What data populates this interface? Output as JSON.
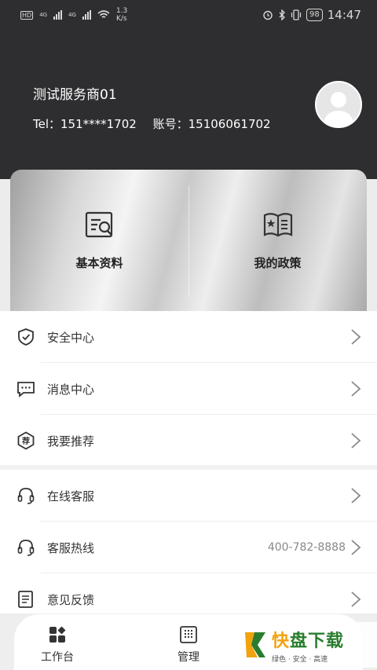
{
  "status_bar": {
    "left_badges": [
      "HD",
      "4G",
      "4G"
    ],
    "speed": "1.3",
    "speed_unit": "K/s",
    "battery": "98",
    "time": "14:47"
  },
  "profile": {
    "name": "测试服务商01",
    "tel": "Tel：151****1702",
    "account": "账号：15106061702"
  },
  "cards": [
    {
      "label": "基本资料",
      "icon": "profile-card-icon"
    },
    {
      "label": "我的政策",
      "icon": "policy-book-icon"
    }
  ],
  "menu_group1": [
    {
      "label": "安全中心",
      "icon": "shield-check-icon"
    },
    {
      "label": "消息中心",
      "icon": "message-icon"
    },
    {
      "label": "我要推荐",
      "icon": "recommend-icon"
    }
  ],
  "menu_group2": [
    {
      "label": "在线客服",
      "icon": "headset-icon"
    },
    {
      "label": "客服热线",
      "icon": "headset-icon",
      "value": "400-782-8888"
    },
    {
      "label": "意见反馈",
      "icon": "feedback-icon"
    }
  ],
  "tabs": [
    {
      "label": "工作台",
      "icon": "workbench-icon"
    },
    {
      "label": "管理",
      "icon": "management-icon"
    }
  ],
  "watermark": {
    "title_a": "快",
    "title_b": "盘下载",
    "subtitle": "绿色 · 安全 · 高速"
  },
  "colors": {
    "header_bg": "#2e2e30",
    "page_bg": "#f2f2f2",
    "watermark_green": "#2a7d2e",
    "watermark_orange": "#f2a20c"
  }
}
